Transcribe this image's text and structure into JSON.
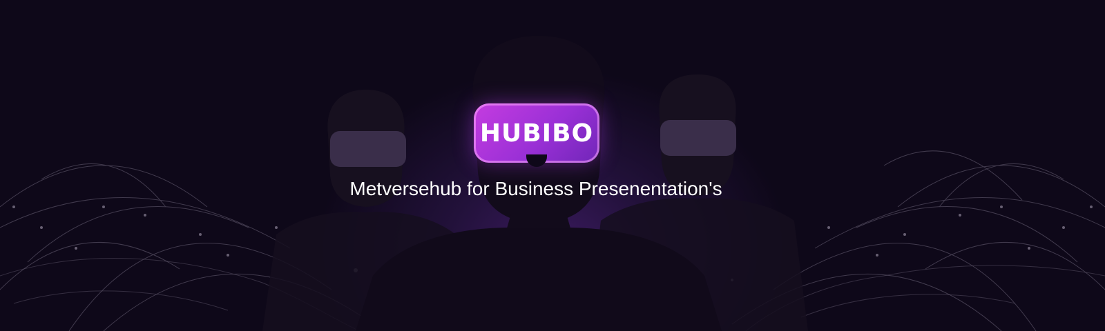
{
  "hero": {
    "logo_text": "HUBIBO",
    "tagline": "Metversehub for Business Presenentation's"
  },
  "colors": {
    "background": "#0e0819",
    "glow": "#3a1a5e",
    "logo_start": "#c53ce0",
    "logo_end": "#7026b8",
    "headset": "#3a2e4a",
    "tagline": "#ffffff"
  }
}
